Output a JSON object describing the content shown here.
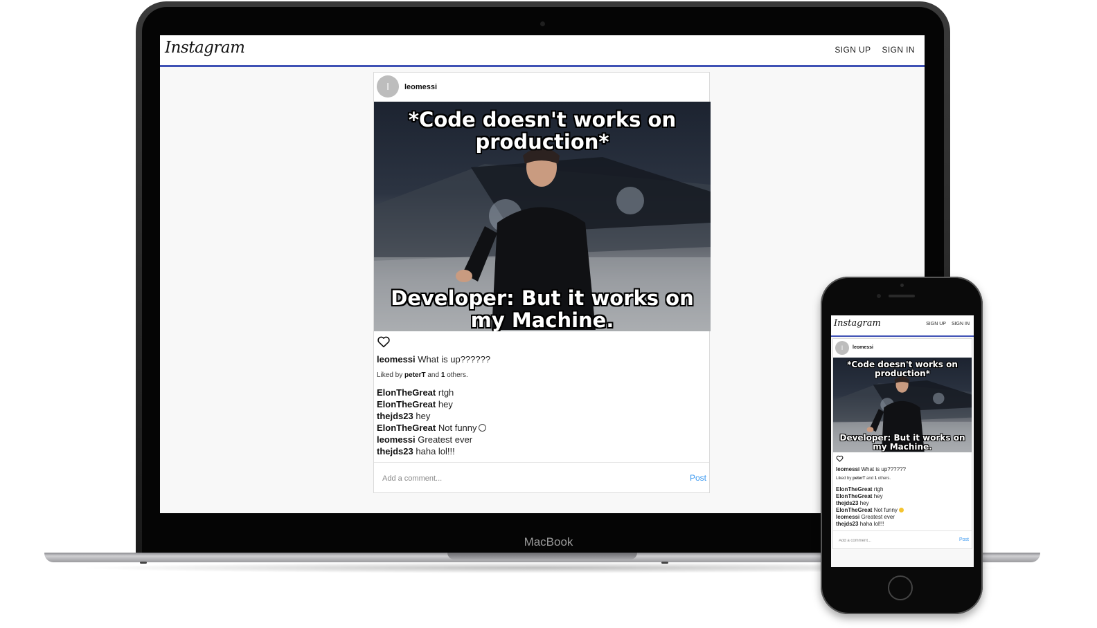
{
  "laptop": {
    "brand_label": "MacBook"
  },
  "app": {
    "logo": "Instagram",
    "nav": {
      "sign_up": "SIGN UP",
      "sign_in": "SIGN IN"
    },
    "post": {
      "avatar_initial": "l",
      "username": "leomessi",
      "image": {
        "top_text": "*Code doesn't works on production*",
        "bottom_text": "Developer: But it works on my Machine."
      },
      "caption": {
        "user": "leomessi",
        "text": "What is up??????"
      },
      "liked_by": {
        "prefix": "Liked by",
        "user": "peterT",
        "and": "and",
        "count": "1",
        "suffix": "others."
      },
      "comments": [
        {
          "user": "ElonTheGreat",
          "text": "rtgh"
        },
        {
          "user": "ElonTheGreat",
          "text": "hey"
        },
        {
          "user": "thejds23",
          "text": "hey"
        },
        {
          "user": "ElonTheGreat",
          "text": "Not funny"
        },
        {
          "user": "leomessi",
          "text": "Greatest ever"
        },
        {
          "user": "thejds23",
          "text": "haha lol!!!"
        }
      ],
      "comment_placeholder": "Add a comment...",
      "post_button": "Post"
    }
  },
  "colors": {
    "header_underline": "#3f51b5",
    "post_link": "#3897f0"
  },
  "icons": {
    "like": "heart-outline-icon",
    "emoji": "unamused-face-icon"
  }
}
